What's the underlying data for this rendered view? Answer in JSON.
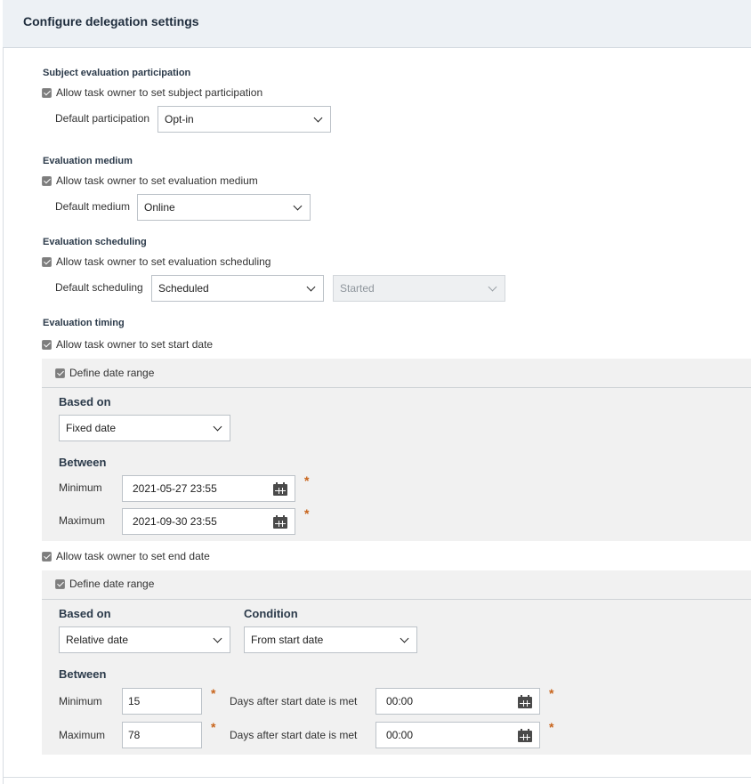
{
  "header": {
    "title": "Configure delegation settings"
  },
  "participation": {
    "section_title": "Subject evaluation participation",
    "allow_label": "Allow task owner to set subject participation",
    "default_label": "Default participation",
    "default_value": "Opt-in",
    "checked": true
  },
  "medium": {
    "section_title": "Evaluation medium",
    "allow_label": "Allow task owner to set evaluation medium",
    "default_label": "Default medium",
    "default_value": "Online",
    "checked": true
  },
  "scheduling": {
    "section_title": "Evaluation scheduling",
    "allow_label": "Allow task owner to set evaluation scheduling",
    "default_label": "Default scheduling",
    "default_value": "Scheduled",
    "status_value": "Started",
    "checked": true
  },
  "timing": {
    "section_title": "Evaluation timing",
    "start": {
      "allow_label": "Allow task owner to set start date",
      "define_range_label": "Define date range",
      "based_on_label": "Based on",
      "based_on_value": "Fixed date",
      "between_label": "Between",
      "minimum_label": "Minimum",
      "minimum_value": "2021-05-27 23:55",
      "maximum_label": "Maximum",
      "maximum_value": "2021-09-30 23:55",
      "required_mark": "*"
    },
    "end": {
      "allow_label": "Allow task owner to set end date",
      "define_range_label": "Define date range",
      "based_on_label": "Based on",
      "based_on_value": "Relative date",
      "condition_label": "Condition",
      "condition_value": "From start date",
      "between_label": "Between",
      "minimum_label": "Minimum",
      "minimum_days": "15",
      "minimum_suffix": "Days after start date is met",
      "minimum_time": "00:00",
      "maximum_label": "Maximum",
      "maximum_days": "78",
      "maximum_suffix": "Days after start date is met",
      "maximum_time": "00:00",
      "required_mark": "*"
    }
  },
  "colors": {
    "header_bg": "#edf1f5",
    "panel_bg": "#f1f1f1",
    "required": "#c8641b"
  }
}
